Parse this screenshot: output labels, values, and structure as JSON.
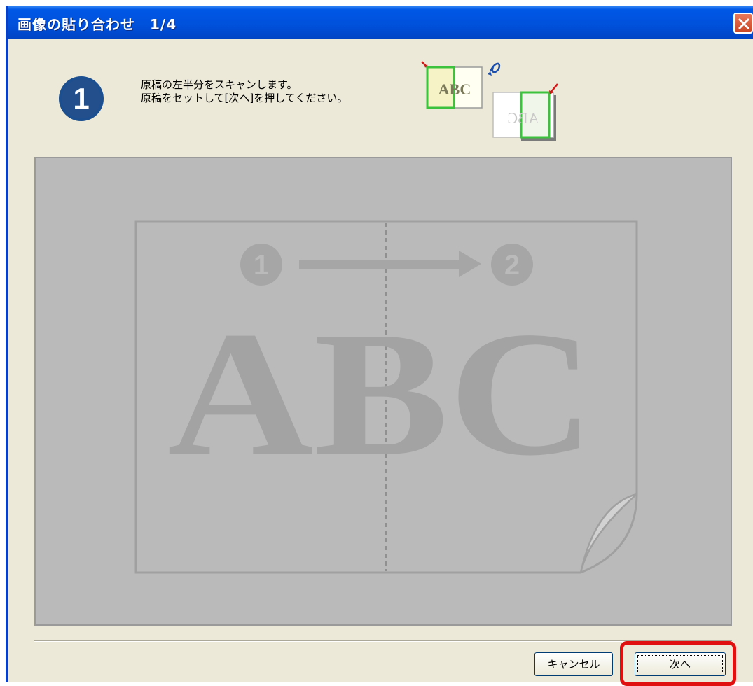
{
  "window": {
    "title": "画像の貼り合わせ　1/4"
  },
  "step": {
    "number": "1",
    "instruction_line1": "原稿の左半分をスキャンします。",
    "instruction_line2": "原稿をセットして[次へ]を押してください。"
  },
  "diagram": {
    "front_text": "ABC",
    "back_text": "ABC"
  },
  "preview": {
    "step_from": "1",
    "step_to": "2",
    "big_text": "ABC"
  },
  "buttons": {
    "cancel_label": "キャンセル",
    "next_label": "次へ"
  },
  "colors": {
    "titlebar": "#0050da",
    "dialog_bg": "#ece9d8",
    "preview_bg": "#bababa",
    "highlight": "#e01010",
    "step_badge": "#1b4f8f",
    "selection_green": "#3cc23c"
  },
  "icons": [
    "close-icon",
    "step-1-badge-icon",
    "scan-left-half-diagram-icon",
    "page-curl-icon",
    "arrow-right-icon"
  ]
}
